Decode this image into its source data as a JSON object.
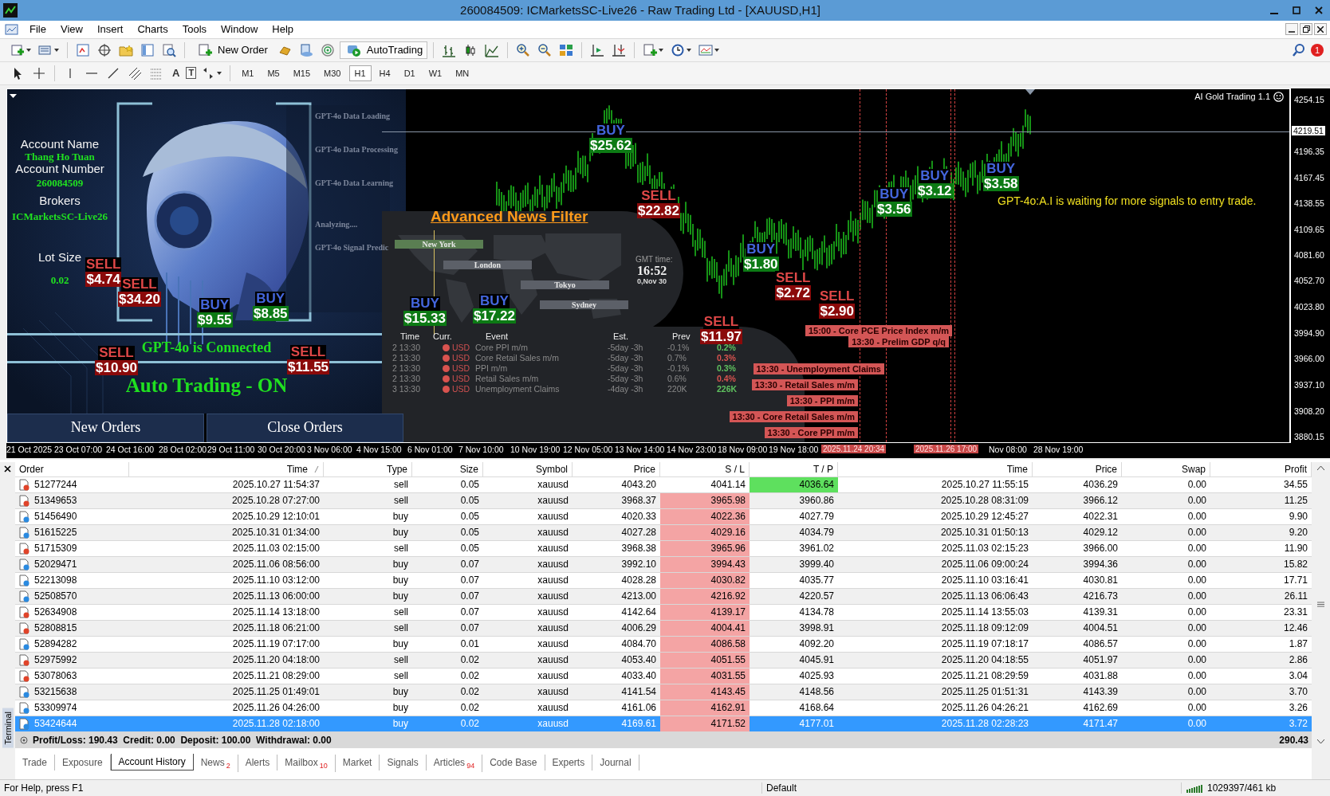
{
  "window": {
    "title": "260084509: ICMarketsSC-Live26 - Raw Trading Ltd - [XAUUSD,H1]"
  },
  "menu": [
    "File",
    "View",
    "Insert",
    "Charts",
    "Tools",
    "Window",
    "Help"
  ],
  "toolbar": {
    "new_order": "New Order",
    "autotrading": "AutoTrading",
    "notification_count": "1",
    "text_tool": "A",
    "label_tool": "T"
  },
  "timeframes": [
    {
      "label": "M1",
      "selected": false
    },
    {
      "label": "M5",
      "selected": false
    },
    {
      "label": "M15",
      "selected": false
    },
    {
      "label": "M30",
      "selected": false
    },
    {
      "label": "H1",
      "selected": true
    },
    {
      "label": "H4",
      "selected": false
    },
    {
      "label": "D1",
      "selected": false
    },
    {
      "label": "W1",
      "selected": false
    },
    {
      "label": "MN",
      "selected": false
    }
  ],
  "chart": {
    "indicator_name": "AI Gold Trading 1.1",
    "status_message": "GPT-4o:A.I is waiting for more signals to entry trade.",
    "price_axis": [
      "4254.15",
      "4196.35",
      "4167.45",
      "4138.55",
      "4109.65",
      "4081.60",
      "4052.70",
      "4023.80",
      "3994.90",
      "3966.00",
      "3937.10",
      "3908.20",
      "3880.15"
    ],
    "current_price": "4219.51",
    "time_axis": [
      {
        "label": "21 Oct 2025",
        "kind": "tick"
      },
      {
        "label": "23 Oct 07:00",
        "kind": "tick"
      },
      {
        "label": "24 Oct 16:00",
        "kind": "tick"
      },
      {
        "label": "28 Oct 02:00",
        "kind": "tick"
      },
      {
        "label": "29 Oct 11:00",
        "kind": "tick"
      },
      {
        "label": "30 Oct 20:00",
        "kind": "tick"
      },
      {
        "label": "3 Nov 06:00",
        "kind": "tick"
      },
      {
        "label": "4 Nov 15:00",
        "kind": "tick"
      },
      {
        "label": "6 Nov 01:00",
        "kind": "tick"
      },
      {
        "label": "7 Nov 10:00",
        "kind": "tick"
      },
      {
        "label": "10 Nov 19:00",
        "kind": "tick"
      },
      {
        "label": "12 Nov 05:00",
        "kind": "tick"
      },
      {
        "label": "13 Nov 14:00",
        "kind": "tick"
      },
      {
        "label": "14 Nov 23:00",
        "kind": "tick"
      },
      {
        "label": "18 Nov 09:00",
        "kind": "tick"
      },
      {
        "label": "19 Nov 18:00",
        "kind": "tick"
      },
      {
        "label": "2025.11.24 20:34",
        "kind": "marker"
      },
      {
        "label": "2025.11.26 17:00",
        "kind": "marker"
      },
      {
        "label": "Nov 08:00",
        "kind": "tick"
      },
      {
        "label": "28 Nov 19:00",
        "kind": "tick"
      }
    ],
    "signals": [
      {
        "kind": "sell",
        "label": "SELL",
        "amount": "$4.74"
      },
      {
        "kind": "sell",
        "label": "SELL",
        "amount": "$34.20"
      },
      {
        "kind": "buy",
        "label": "BUY",
        "amount": "$9.55"
      },
      {
        "kind": "buy",
        "label": "BUY",
        "amount": "$8.85"
      },
      {
        "kind": "sell",
        "label": "SELL",
        "amount": "$10.90"
      },
      {
        "kind": "sell",
        "label": "SELL",
        "amount": "$11.55"
      },
      {
        "kind": "buy",
        "label": "BUY",
        "amount": "$15.33"
      },
      {
        "kind": "buy",
        "label": "BUY",
        "amount": "$17.22"
      },
      {
        "kind": "buy",
        "label": "BUY",
        "amount": "$25.62"
      },
      {
        "kind": "sell",
        "label": "SELL",
        "amount": "$22.82"
      },
      {
        "kind": "sell",
        "label": "SELL",
        "amount": "$11.97"
      },
      {
        "kind": "buy",
        "label": "BUY",
        "amount": "$1.80"
      },
      {
        "kind": "sell",
        "label": "SELL",
        "amount": "$2.72"
      },
      {
        "kind": "sell",
        "label": "SELL",
        "amount": "$2.90"
      },
      {
        "kind": "buy",
        "label": "BUY",
        "amount": "$3.56"
      },
      {
        "kind": "buy",
        "label": "BUY",
        "amount": "$3.12"
      },
      {
        "kind": "buy",
        "label": "BUY",
        "amount": "$3.58"
      }
    ],
    "event_tags": [
      "15:00 - Core PCE Price Index m/m",
      "13:30 - Prelim GDP q/q",
      "13:30 - Unemployment Claims",
      "13:30 - Retail Sales m/m",
      "13:30 - PPI m/m",
      "13:30 - Core Retail Sales m/m",
      "13:30 - Core PPI m/m"
    ]
  },
  "ea_panel": {
    "account_name_label": "Account Name",
    "account_name": "Thang Ho Tuan",
    "account_number_label": "Account Number",
    "account_number": "260084509",
    "broker_label": "Brokers",
    "broker": "ICMarketsSC-Live26",
    "lot_size_label": "Lot Size",
    "lot_size": "0.02",
    "status_lines": [
      "GPT-4o Data Loading",
      "GPT-4o Data Processing",
      "GPT-4o Data Learning",
      "Analyzing....",
      "GPT-4o Signal Predic"
    ],
    "connection": "GPT-4o is Connected",
    "auto_trading": "Auto Trading - ON",
    "buttons": [
      "New Orders",
      "Close Orders"
    ]
  },
  "news_filter": {
    "title": "Advanced News Filter",
    "sessions": [
      "New York",
      "London",
      "Tokyo",
      "Sydney"
    ],
    "gmt_label": "GMT time:",
    "gmt_time": "16:52",
    "gmt_date": "0,Nov 30",
    "columns": [
      "Time",
      "Curr.",
      "Event",
      "Est.",
      "Prev"
    ],
    "events": [
      {
        "time": "2 13:30",
        "currency": "USD",
        "event": "Core PPI m/m",
        "estimate": "-5day -3h",
        "previous": "-0.1%",
        "actual": "0.2%",
        "color": "#5fc25f"
      },
      {
        "time": "2 13:30",
        "currency": "USD",
        "event": "Core Retail Sales m/m",
        "estimate": "-5day -3h",
        "previous": "0.7%",
        "actual": "0.3%",
        "color": "#d9534f"
      },
      {
        "time": "2 13:30",
        "currency": "USD",
        "event": "PPI m/m",
        "estimate": "-5day -3h",
        "previous": "-0.1%",
        "actual": "0.3%",
        "color": "#5fc25f"
      },
      {
        "time": "2 13:30",
        "currency": "USD",
        "event": "Retail Sales m/m",
        "estimate": "-5day -3h",
        "previous": "0.6%",
        "actual": "0.4%",
        "color": "#d9534f"
      },
      {
        "time": "3 13:30",
        "currency": "USD",
        "event": "Unemployment Claims",
        "estimate": "-4day -3h",
        "previous": "220K",
        "actual": "226K",
        "color": "#5fc25f"
      }
    ]
  },
  "terminal": {
    "side_label": "Terminal",
    "columns": [
      "Order",
      "Time",
      "Type",
      "Size",
      "Symbol",
      "Price",
      "S / L",
      "T / P",
      "Time",
      "Price",
      "Swap",
      "Profit"
    ],
    "rows": [
      {
        "cells": [
          "51277244",
          "2025.10.27 11:54:37",
          "sell",
          "0.05",
          "xauusd",
          "4043.20",
          "4041.14",
          "4036.64",
          "2025.10.27 11:55:15",
          "4036.29",
          "0.00",
          "34.55"
        ],
        "color": "#e0442a",
        "sl_hit": false,
        "tp_hit": true,
        "selected": false
      },
      {
        "cells": [
          "51349653",
          "2025.10.28 07:27:00",
          "sell",
          "0.05",
          "xauusd",
          "3968.37",
          "3965.98",
          "3960.86",
          "2025.10.28 08:31:09",
          "3966.12",
          "0.00",
          "11.25"
        ],
        "color": "#e0442a",
        "sl_hit": true,
        "tp_hit": false,
        "selected": false
      },
      {
        "cells": [
          "51456490",
          "2025.10.29 12:10:01",
          "buy",
          "0.05",
          "xauusd",
          "4020.33",
          "4022.36",
          "4027.79",
          "2025.10.29 12:45:27",
          "4022.31",
          "0.00",
          "9.90"
        ],
        "color": "#2a8ae0",
        "sl_hit": true,
        "tp_hit": false,
        "selected": false
      },
      {
        "cells": [
          "51615225",
          "2025.10.31 01:34:00",
          "buy",
          "0.05",
          "xauusd",
          "4027.28",
          "4029.16",
          "4034.79",
          "2025.10.31 01:50:13",
          "4029.12",
          "0.00",
          "9.20"
        ],
        "color": "#2a8ae0",
        "sl_hit": true,
        "tp_hit": false,
        "selected": false
      },
      {
        "cells": [
          "51715309",
          "2025.11.03 02:15:00",
          "sell",
          "0.05",
          "xauusd",
          "3968.38",
          "3965.96",
          "3961.02",
          "2025.11.03 02:15:23",
          "3966.00",
          "0.00",
          "11.90"
        ],
        "color": "#e0442a",
        "sl_hit": true,
        "tp_hit": false,
        "selected": false
      },
      {
        "cells": [
          "52029471",
          "2025.11.06 08:56:00",
          "buy",
          "0.07",
          "xauusd",
          "3992.10",
          "3994.43",
          "3999.40",
          "2025.11.06 09:00:24",
          "3994.36",
          "0.00",
          "15.82"
        ],
        "color": "#2a8ae0",
        "sl_hit": true,
        "tp_hit": false,
        "selected": false
      },
      {
        "cells": [
          "52213098",
          "2025.11.10 03:12:00",
          "buy",
          "0.07",
          "xauusd",
          "4028.28",
          "4030.82",
          "4035.77",
          "2025.11.10 03:16:41",
          "4030.81",
          "0.00",
          "17.71"
        ],
        "color": "#2a8ae0",
        "sl_hit": true,
        "tp_hit": false,
        "selected": false
      },
      {
        "cells": [
          "52508570",
          "2025.11.13 06:00:00",
          "buy",
          "0.07",
          "xauusd",
          "4213.00",
          "4216.92",
          "4220.57",
          "2025.11.13 06:06:43",
          "4216.73",
          "0.00",
          "26.11"
        ],
        "color": "#2a8ae0",
        "sl_hit": true,
        "tp_hit": false,
        "selected": false
      },
      {
        "cells": [
          "52634908",
          "2025.11.14 13:18:00",
          "sell",
          "0.07",
          "xauusd",
          "4142.64",
          "4139.17",
          "4134.78",
          "2025.11.14 13:55:03",
          "4139.31",
          "0.00",
          "23.31"
        ],
        "color": "#e0442a",
        "sl_hit": true,
        "tp_hit": false,
        "selected": false
      },
      {
        "cells": [
          "52808815",
          "2025.11.18 06:21:00",
          "sell",
          "0.07",
          "xauusd",
          "4006.29",
          "4004.41",
          "3998.91",
          "2025.11.18 09:12:09",
          "4004.51",
          "0.00",
          "12.46"
        ],
        "color": "#e0442a",
        "sl_hit": true,
        "tp_hit": false,
        "selected": false
      },
      {
        "cells": [
          "52894282",
          "2025.11.19 07:17:00",
          "buy",
          "0.01",
          "xauusd",
          "4084.70",
          "4086.58",
          "4092.20",
          "2025.11.19 07:18:17",
          "4086.57",
          "0.00",
          "1.87"
        ],
        "color": "#2a8ae0",
        "sl_hit": true,
        "tp_hit": false,
        "selected": false
      },
      {
        "cells": [
          "52975992",
          "2025.11.20 04:18:00",
          "sell",
          "0.02",
          "xauusd",
          "4053.40",
          "4051.55",
          "4045.91",
          "2025.11.20 04:18:55",
          "4051.97",
          "0.00",
          "2.86"
        ],
        "color": "#e0442a",
        "sl_hit": true,
        "tp_hit": false,
        "selected": false
      },
      {
        "cells": [
          "53078063",
          "2025.11.21 08:29:00",
          "sell",
          "0.02",
          "xauusd",
          "4033.40",
          "4031.55",
          "4025.93",
          "2025.11.21 08:29:59",
          "4031.88",
          "0.00",
          "3.04"
        ],
        "color": "#e0442a",
        "sl_hit": true,
        "tp_hit": false,
        "selected": false
      },
      {
        "cells": [
          "53215638",
          "2025.11.25 01:49:01",
          "buy",
          "0.02",
          "xauusd",
          "4141.54",
          "4143.45",
          "4148.56",
          "2025.11.25 01:51:31",
          "4143.39",
          "0.00",
          "3.70"
        ],
        "color": "#2a8ae0",
        "sl_hit": true,
        "tp_hit": false,
        "selected": false
      },
      {
        "cells": [
          "53309974",
          "2025.11.26 04:26:00",
          "buy",
          "0.02",
          "xauusd",
          "4161.06",
          "4162.91",
          "4168.64",
          "2025.11.26 04:26:21",
          "4162.69",
          "0.00",
          "3.26"
        ],
        "color": "#2a8ae0",
        "sl_hit": true,
        "tp_hit": false,
        "selected": false
      },
      {
        "cells": [
          "53424644",
          "2025.11.28 02:18:00",
          "buy",
          "0.02",
          "xauusd",
          "4169.61",
          "4171.52",
          "4177.01",
          "2025.11.28 02:28:23",
          "4171.47",
          "0.00",
          "3.72"
        ],
        "color": "#2a8ae0",
        "sl_hit": true,
        "tp_hit": false,
        "selected": true
      }
    ],
    "summary": "Profit/Loss: 190.43  Credit: 0.00  Deposit: 100.00  Withdrawal: 0.00",
    "total": "290.43",
    "tabs": [
      {
        "label": "Trade",
        "selected": false
      },
      {
        "label": "Exposure",
        "selected": false
      },
      {
        "label": "Account History",
        "selected": true
      },
      {
        "label": "News",
        "badge": "2",
        "selected": false
      },
      {
        "label": "Alerts",
        "selected": false
      },
      {
        "label": "Mailbox",
        "badge": "10",
        "selected": false
      },
      {
        "label": "Market",
        "selected": false
      },
      {
        "label": "Signals",
        "selected": false
      },
      {
        "label": "Articles",
        "badge": "94",
        "selected": false
      },
      {
        "label": "Code Base",
        "selected": false
      },
      {
        "label": "Experts",
        "selected": false
      },
      {
        "label": "Journal",
        "selected": false
      }
    ]
  },
  "status_bar": {
    "help": "For Help, press F1",
    "profile": "Default",
    "traffic": "1029397/461 kb"
  }
}
